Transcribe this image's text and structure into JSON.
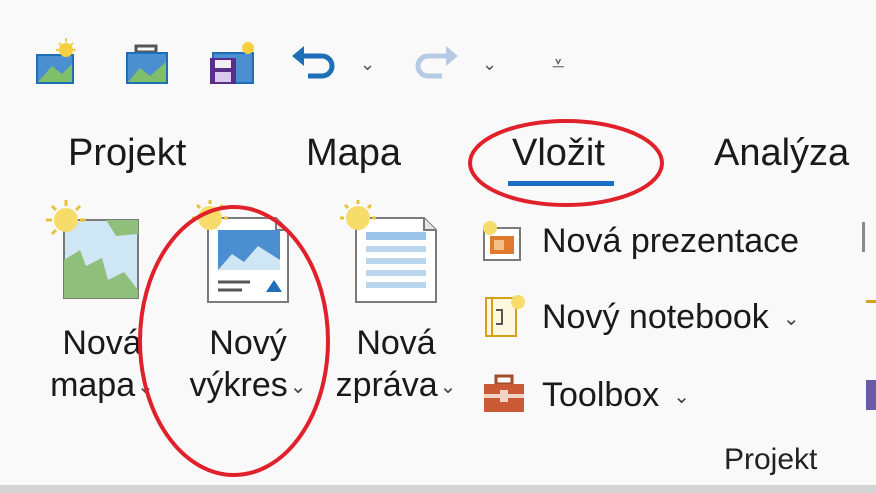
{
  "quick_access": {
    "icons": [
      "new-project-icon",
      "open-project-icon",
      "save-project-icon",
      "undo-icon",
      "redo-icon",
      "customize-toolbar-icon"
    ],
    "chevron": "⌄",
    "overflow": "⩡"
  },
  "tabs": [
    {
      "label": "Projekt",
      "active": false
    },
    {
      "label": "Mapa",
      "active": false
    },
    {
      "label": "Vložit",
      "active": true
    },
    {
      "label": "Analýza",
      "active": false
    }
  ],
  "ribbon": {
    "big_buttons": [
      {
        "line1": "Nová",
        "line2": "mapa",
        "icon": "new-map-icon"
      },
      {
        "line1": "Nový",
        "line2": "výkres",
        "icon": "new-layout-icon"
      },
      {
        "line1": "Nová",
        "line2": "zpráva",
        "icon": "new-report-icon"
      }
    ],
    "small_buttons": [
      {
        "label": "Nová prezentace",
        "icon": "new-presentation-icon"
      },
      {
        "label": "Nový notebook",
        "icon": "new-notebook-icon"
      },
      {
        "label": "Toolbox",
        "icon": "toolbox-icon"
      }
    ],
    "dropdown_chevron": "⌄",
    "group_label": "Projekt"
  },
  "colors": {
    "accent": "#1a6fc4",
    "highlight": "#e0202a",
    "background": "#f9f9f9"
  }
}
